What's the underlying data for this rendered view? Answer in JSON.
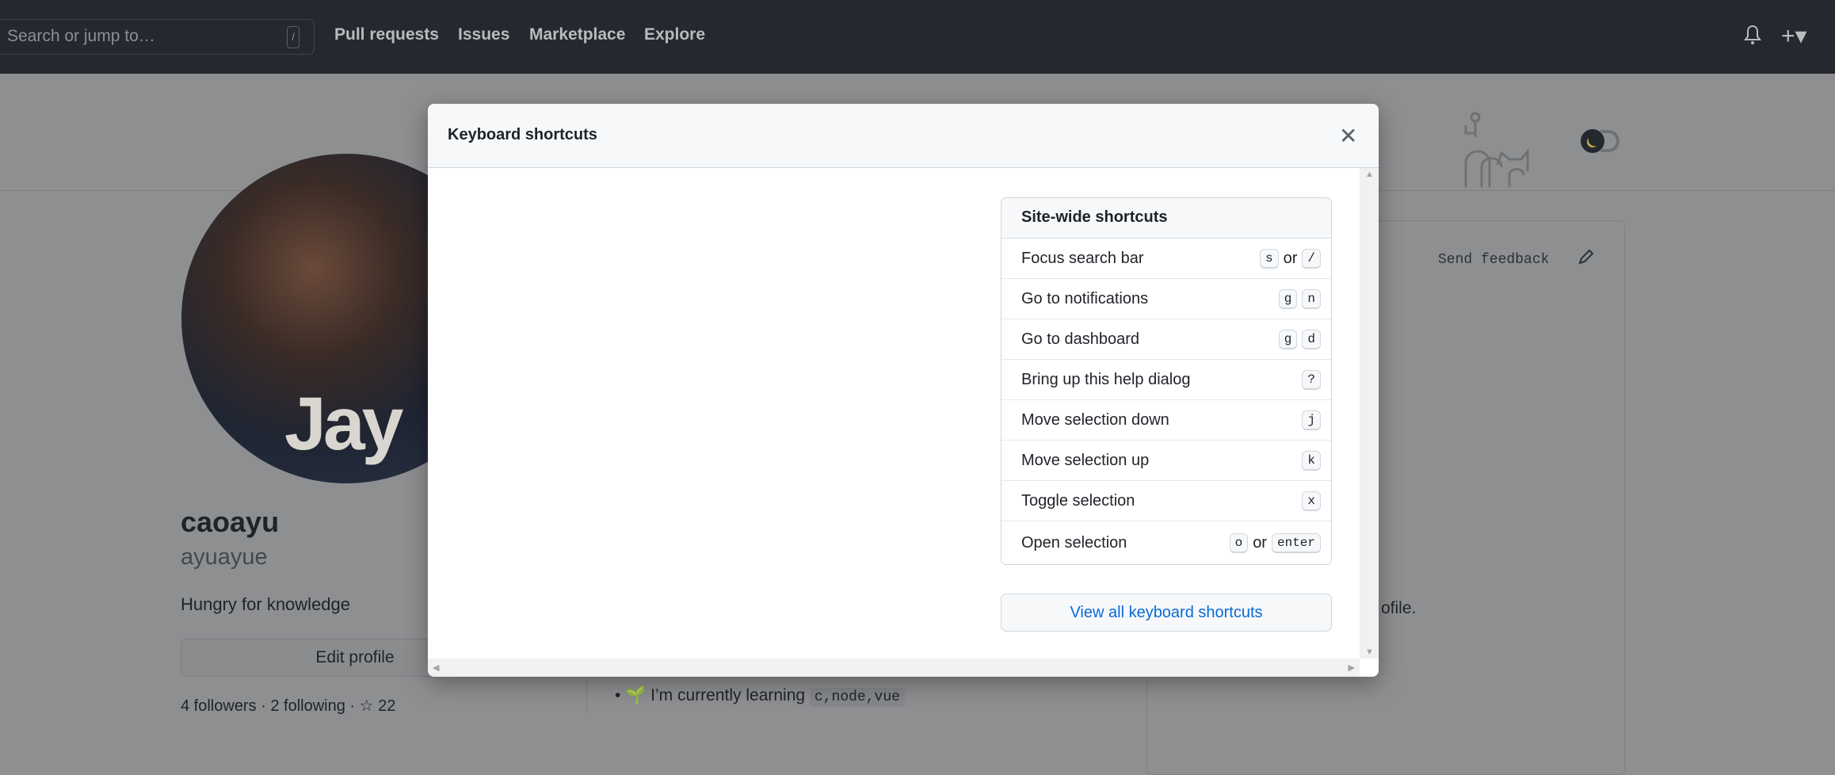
{
  "header": {
    "search_placeholder": "Search or jump to…",
    "search_shortcut": "/",
    "nav": [
      "Pull requests",
      "Issues",
      "Marketplace",
      "Explore"
    ]
  },
  "profile": {
    "avatar_text": "Jay",
    "name": "caoayu",
    "login": "ayuayue",
    "bio": "Hungry for knowledge",
    "edit_button": "Edit profile",
    "followers": "4 followers · 2 following · ☆ 22"
  },
  "readme": {
    "send_feedback": "Send feedback",
    "partial_text": "ofile.",
    "learning_prefix": "🌱 I’m currently learning",
    "learning_code": "c,node,vue"
  },
  "modal": {
    "title": "Keyboard shortcuts",
    "section_title": "Site-wide shortcuts",
    "or_label": "or",
    "shortcuts": [
      {
        "label": "Focus search bar",
        "keys": [
          "s",
          "/"
        ],
        "alt": true
      },
      {
        "label": "Go to notifications",
        "keys": [
          "g",
          "n"
        ],
        "alt": false
      },
      {
        "label": "Go to dashboard",
        "keys": [
          "g",
          "d"
        ],
        "alt": false
      },
      {
        "label": "Bring up this help dialog",
        "keys": [
          "?"
        ],
        "alt": false
      },
      {
        "label": "Move selection down",
        "keys": [
          "j"
        ],
        "alt": false
      },
      {
        "label": "Move selection up",
        "keys": [
          "k"
        ],
        "alt": false
      },
      {
        "label": "Toggle selection",
        "keys": [
          "x"
        ],
        "alt": false
      },
      {
        "label": "Open selection",
        "keys": [
          "o",
          "enter"
        ],
        "alt": true
      }
    ],
    "view_all": "View all keyboard shortcuts"
  },
  "colors": {
    "header_bg": "#24292f",
    "link": "#0969da",
    "overlay": "#8e8f91"
  }
}
